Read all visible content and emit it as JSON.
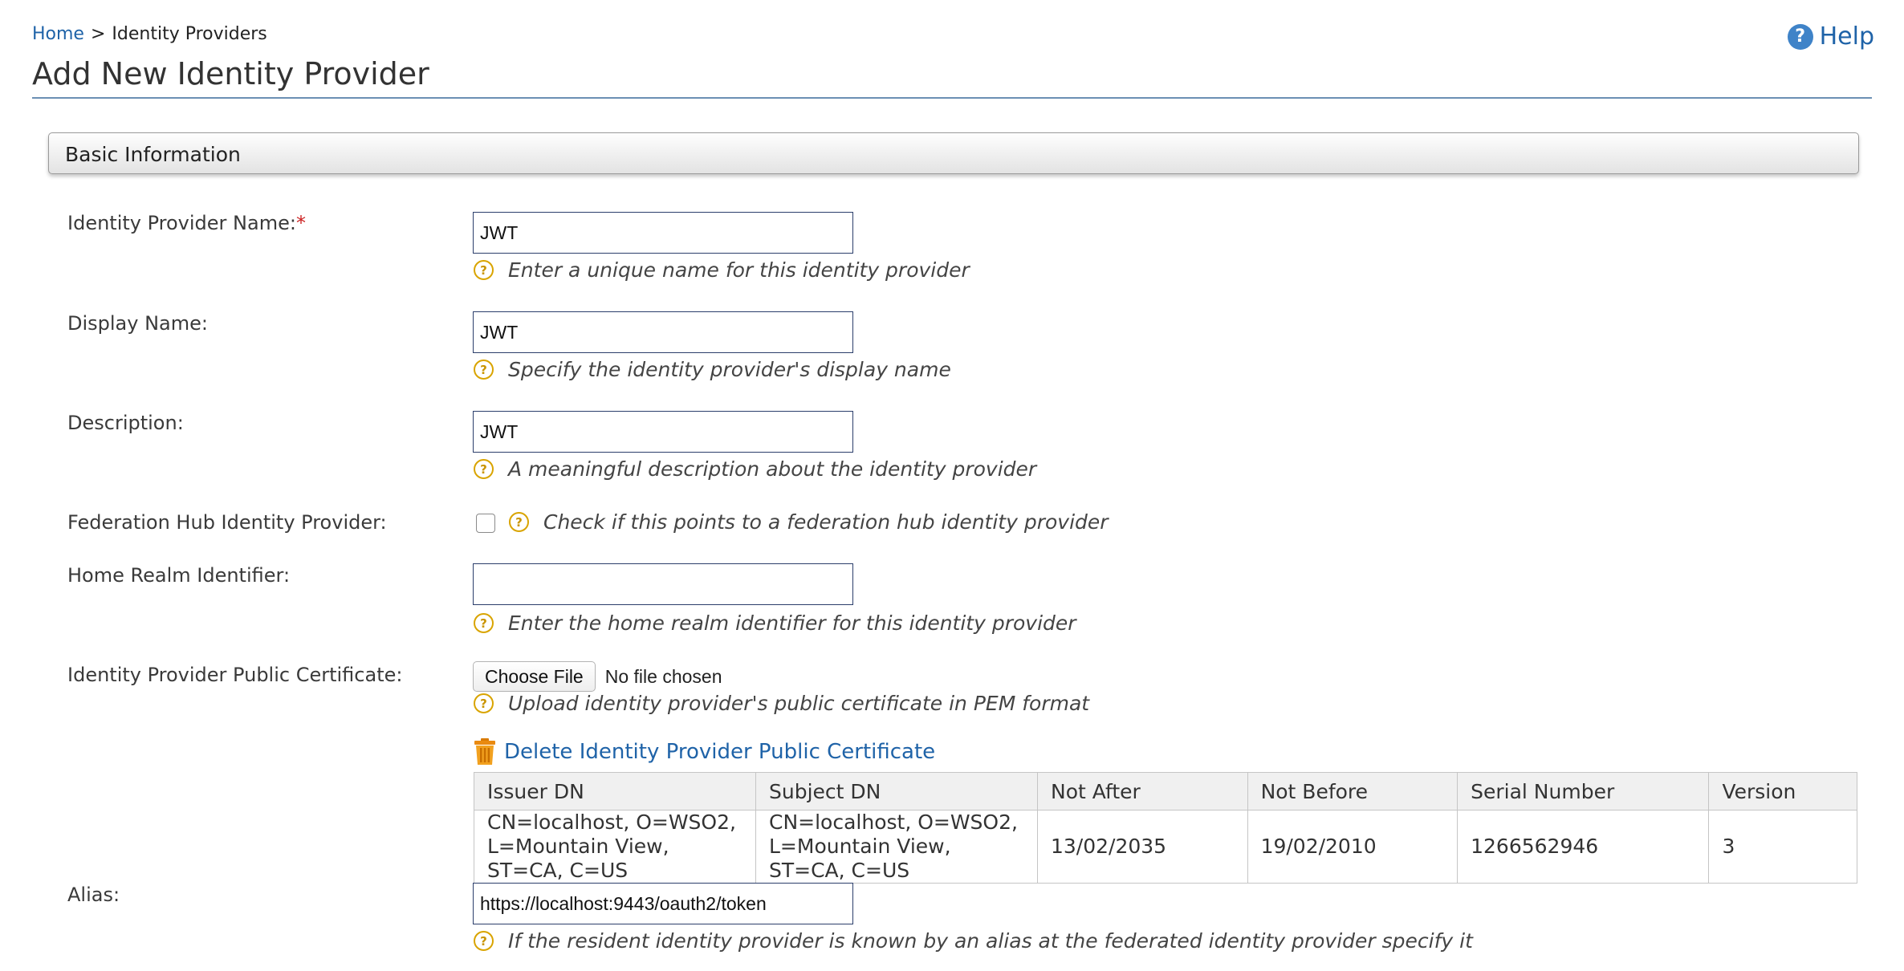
{
  "breadcrumb": {
    "home": "Home",
    "separator": ">",
    "current": "Identity Providers"
  },
  "help": {
    "icon": "?",
    "label": "Help"
  },
  "page": {
    "title": "Add New Identity Provider"
  },
  "section": {
    "title": "Basic Information"
  },
  "form": {
    "idp_name": {
      "label": "Identity Provider Name:",
      "required_mark": "*",
      "value": "JWT",
      "hint": "Enter a unique name for this identity provider"
    },
    "display_name": {
      "label": "Display Name:",
      "value": "JWT",
      "hint": "Specify the identity provider's display name"
    },
    "description": {
      "label": "Description:",
      "value": "JWT",
      "hint": "A meaningful description about the identity provider"
    },
    "federation_hub": {
      "label": "Federation Hub Identity Provider:",
      "checked": false,
      "hint": "Check if this points to a federation hub identity provider"
    },
    "home_realm": {
      "label": "Home Realm Identifier:",
      "value": "",
      "hint": "Enter the home realm identifier for this identity provider"
    },
    "public_cert": {
      "label": "Identity Provider Public Certificate:",
      "button": "Choose File",
      "status": "No file chosen",
      "hint": "Upload identity provider's public certificate in PEM format",
      "delete_label": "Delete Identity Provider Public Certificate"
    },
    "alias": {
      "label": "Alias:",
      "value": "https://localhost:9443/oauth2/token",
      "hint": "If the resident identity provider is known by an alias at the federated identity provider specify it"
    }
  },
  "hint_icon": "?",
  "cert_table": {
    "columns": [
      "Issuer DN",
      "Subject DN",
      "Not After",
      "Not Before",
      "Serial Number",
      "Version"
    ],
    "rows": [
      [
        "CN=localhost, O=WSO2, L=Mountain View, ST=CA, C=US",
        "CN=localhost, O=WSO2, L=Mountain View, ST=CA, C=US",
        "13/02/2035",
        "19/02/2010",
        "1266562946",
        "3"
      ]
    ]
  },
  "colors": {
    "link": "#1f63a8",
    "required": "#cc2222",
    "hint_icon": "#d9a400",
    "title_rule": "#6b8fb4"
  }
}
